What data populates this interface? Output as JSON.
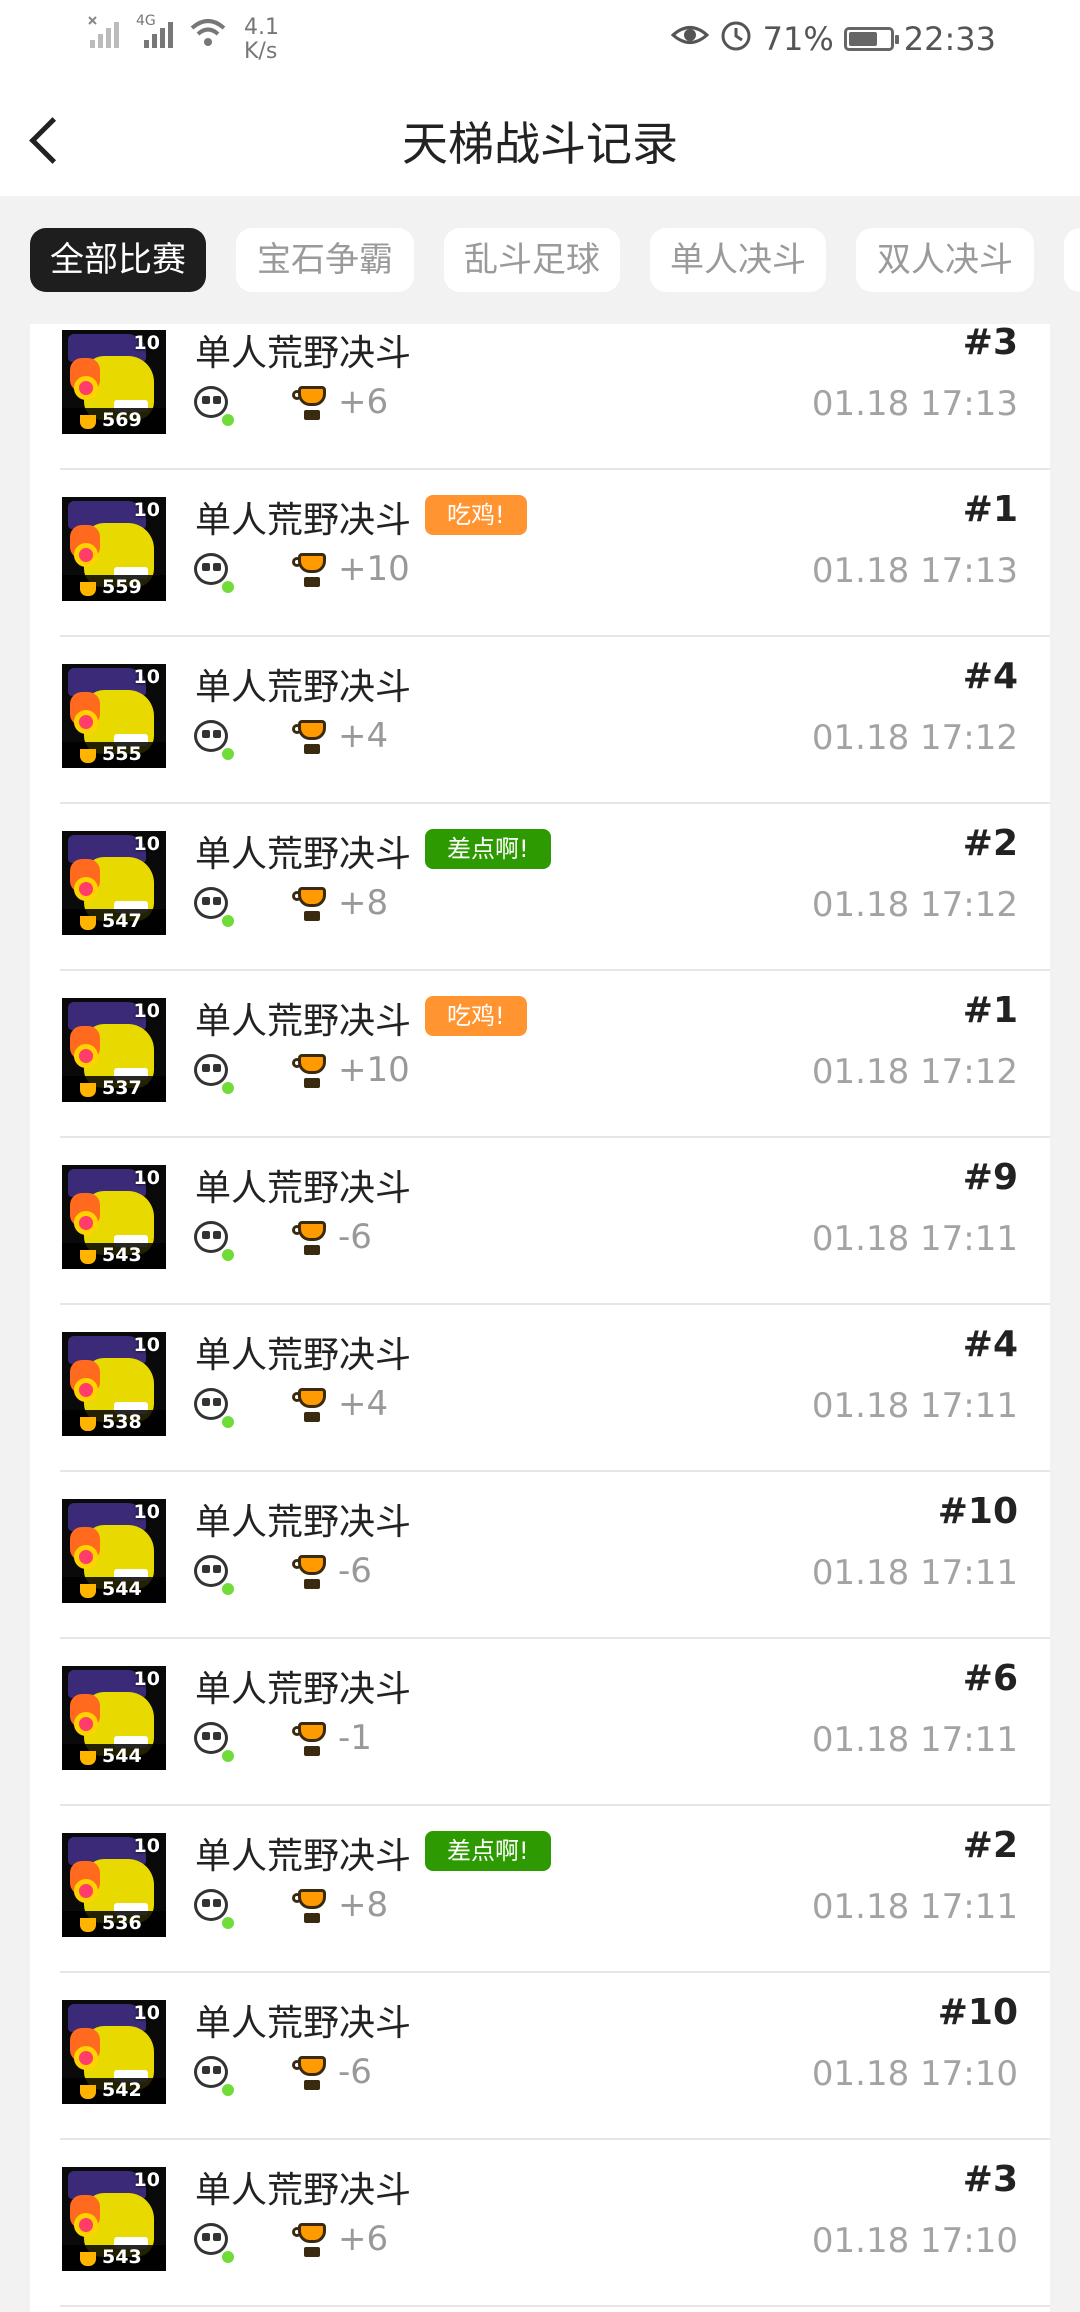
{
  "status_bar": {
    "speed_value": "4.1",
    "speed_unit": "K/s",
    "network": "4G",
    "battery_percent": "71%",
    "battery_level": 0.71,
    "time": "22:33"
  },
  "header": {
    "title": "天梯战斗记录"
  },
  "tabs": [
    {
      "label": "全部比赛",
      "active": true
    },
    {
      "label": "宝石争霸",
      "active": false
    },
    {
      "label": "乱斗足球",
      "active": false
    },
    {
      "label": "单人决斗",
      "active": false
    },
    {
      "label": "双人决斗",
      "active": false
    }
  ],
  "records": [
    {
      "mode": "单人荒野决斗",
      "tag": "",
      "rank": "#3",
      "trophies": "569",
      "level": "10",
      "delta": "+6",
      "time": "01.18 17:13"
    },
    {
      "mode": "单人荒野决斗",
      "tag": "吃鸡!",
      "rank": "#1",
      "trophies": "559",
      "level": "10",
      "delta": "+10",
      "time": "01.18 17:13"
    },
    {
      "mode": "单人荒野决斗",
      "tag": "",
      "rank": "#4",
      "trophies": "555",
      "level": "10",
      "delta": "+4",
      "time": "01.18 17:12"
    },
    {
      "mode": "单人荒野决斗",
      "tag": "差点啊!",
      "rank": "#2",
      "trophies": "547",
      "level": "10",
      "delta": "+8",
      "time": "01.18 17:12"
    },
    {
      "mode": "单人荒野决斗",
      "tag": "吃鸡!",
      "rank": "#1",
      "trophies": "537",
      "level": "10",
      "delta": "+10",
      "time": "01.18 17:12"
    },
    {
      "mode": "单人荒野决斗",
      "tag": "",
      "rank": "#9",
      "trophies": "543",
      "level": "10",
      "delta": "-6",
      "time": "01.18 17:11"
    },
    {
      "mode": "单人荒野决斗",
      "tag": "",
      "rank": "#4",
      "trophies": "538",
      "level": "10",
      "delta": "+4",
      "time": "01.18 17:11"
    },
    {
      "mode": "单人荒野决斗",
      "tag": "",
      "rank": "#10",
      "trophies": "544",
      "level": "10",
      "delta": "-6",
      "time": "01.18 17:11"
    },
    {
      "mode": "单人荒野决斗",
      "tag": "",
      "rank": "#6",
      "trophies": "544",
      "level": "10",
      "delta": "-1",
      "time": "01.18 17:11"
    },
    {
      "mode": "单人荒野决斗",
      "tag": "差点啊!",
      "rank": "#2",
      "trophies": "536",
      "level": "10",
      "delta": "+8",
      "time": "01.18 17:11"
    },
    {
      "mode": "单人荒野决斗",
      "tag": "",
      "rank": "#10",
      "trophies": "542",
      "level": "10",
      "delta": "-6",
      "time": "01.18 17:10"
    },
    {
      "mode": "单人荒野决斗",
      "tag": "",
      "rank": "#3",
      "trophies": "543",
      "level": "10",
      "delta": "+6",
      "time": "01.18 17:10"
    }
  ],
  "colors": {
    "win_tag": "#ff9430",
    "near_tag": "#2c9a00",
    "active_tab": "#1e1e1e"
  }
}
